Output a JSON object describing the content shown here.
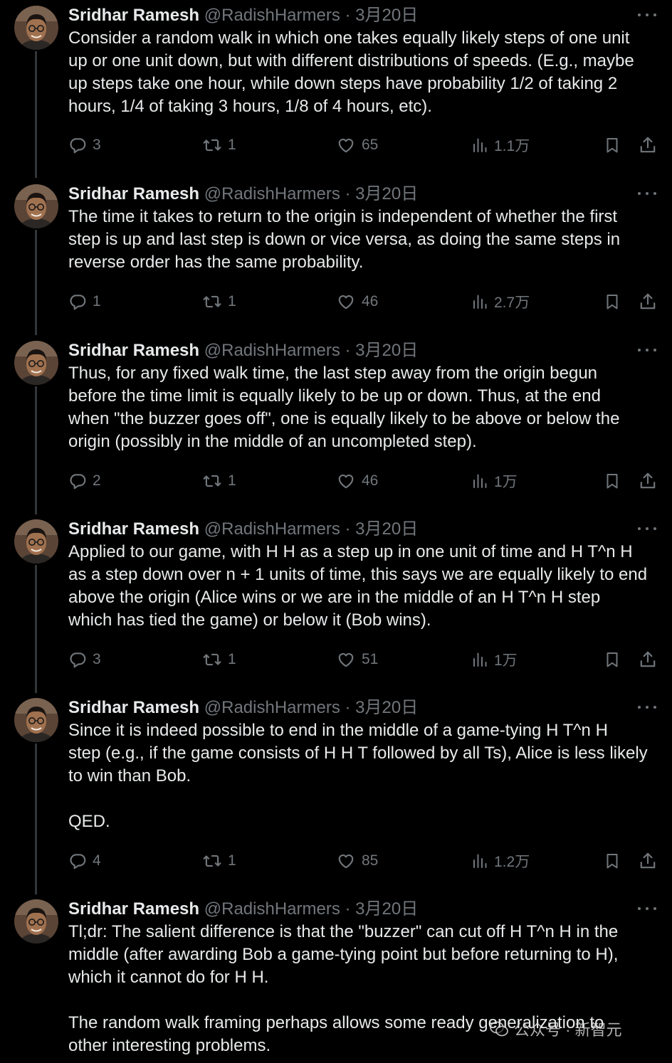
{
  "colors": {
    "background": "#000000",
    "text": "#e7e9ea",
    "secondary": "#71767b",
    "thread_line": "#333639"
  },
  "tweets": [
    {
      "name": "Sridhar Ramesh",
      "handle": "@RadishHarmers",
      "separator": "·",
      "date": "3月20日",
      "lines": [
        "Consider a random walk in which one takes equally likely steps of one unit",
        "up or one unit down, but with different distributions of speeds. (E.g., maybe",
        "up steps take one hour, while down steps have probability 1/2 of taking 2",
        "hours, 1/4 of taking 3 hours, 1/8 of 4 hours, etc)."
      ],
      "replies": "3",
      "retweets": "1",
      "likes": "65",
      "views": "1.1万"
    },
    {
      "name": "Sridhar Ramesh",
      "handle": "@RadishHarmers",
      "separator": "·",
      "date": "3月20日",
      "lines": [
        "The time it takes to return to the origin is independent of whether the first",
        "step is up and last step is down or vice versa, as doing the same steps in",
        "reverse order has the same probability."
      ],
      "replies": "1",
      "retweets": "1",
      "likes": "46",
      "views": "2.7万"
    },
    {
      "name": "Sridhar Ramesh",
      "handle": "@RadishHarmers",
      "separator": "·",
      "date": "3月20日",
      "lines": [
        "Thus, for any fixed walk time, the last step away from the origin begun",
        "before the time limit is equally likely to be up or down. Thus, at the end",
        "when \"the buzzer goes off\", one is equally likely to be above or below the",
        "origin (possibly in the middle of an uncompleted step)."
      ],
      "replies": "2",
      "retweets": "1",
      "likes": "46",
      "views": "1万"
    },
    {
      "name": "Sridhar Ramesh",
      "handle": "@RadishHarmers",
      "separator": "·",
      "date": "3月20日",
      "lines": [
        "Applied to our game, with H H as a step up in one unit of time and H T^n H",
        "as a step down over n + 1 units of time, this says we are equally likely to end",
        "above the origin (Alice wins or we are in the middle of an H T^n H step",
        "which has tied the game) or below it (Bob wins)."
      ],
      "replies": "3",
      "retweets": "1",
      "likes": "51",
      "views": "1万"
    },
    {
      "name": "Sridhar Ramesh",
      "handle": "@RadishHarmers",
      "separator": "·",
      "date": "3月20日",
      "lines": [
        "Since it is indeed possible to end in the middle of a game-tying H T^n H",
        "step (e.g., if the game consists of H H T followed by all Ts), Alice is less likely",
        "to win than Bob.",
        "",
        "QED."
      ],
      "replies": "4",
      "retweets": "1",
      "likes": "85",
      "views": "1.2万"
    },
    {
      "name": "Sridhar Ramesh",
      "handle": "@RadishHarmers",
      "separator": "·",
      "date": "3月20日",
      "lines": [
        "Tl;dr: The salient difference is that the \"buzzer\" can cut off H T^n H in the",
        "middle (after awarding Bob a game-tying point but before returning to H),",
        "which it cannot do for H H.",
        "",
        "The random walk framing perhaps allows some ready generalization to",
        "other interesting problems."
      ]
    }
  ],
  "icons": {
    "reply": "reply-icon",
    "retweet": "retweet-icon",
    "like": "heart-icon",
    "views": "views-icon",
    "bookmark": "bookmark-icon",
    "share": "share-icon",
    "more": "more-icon",
    "watermark": "wechat-icon"
  },
  "watermark": {
    "text": "公众号 · 新智元"
  }
}
